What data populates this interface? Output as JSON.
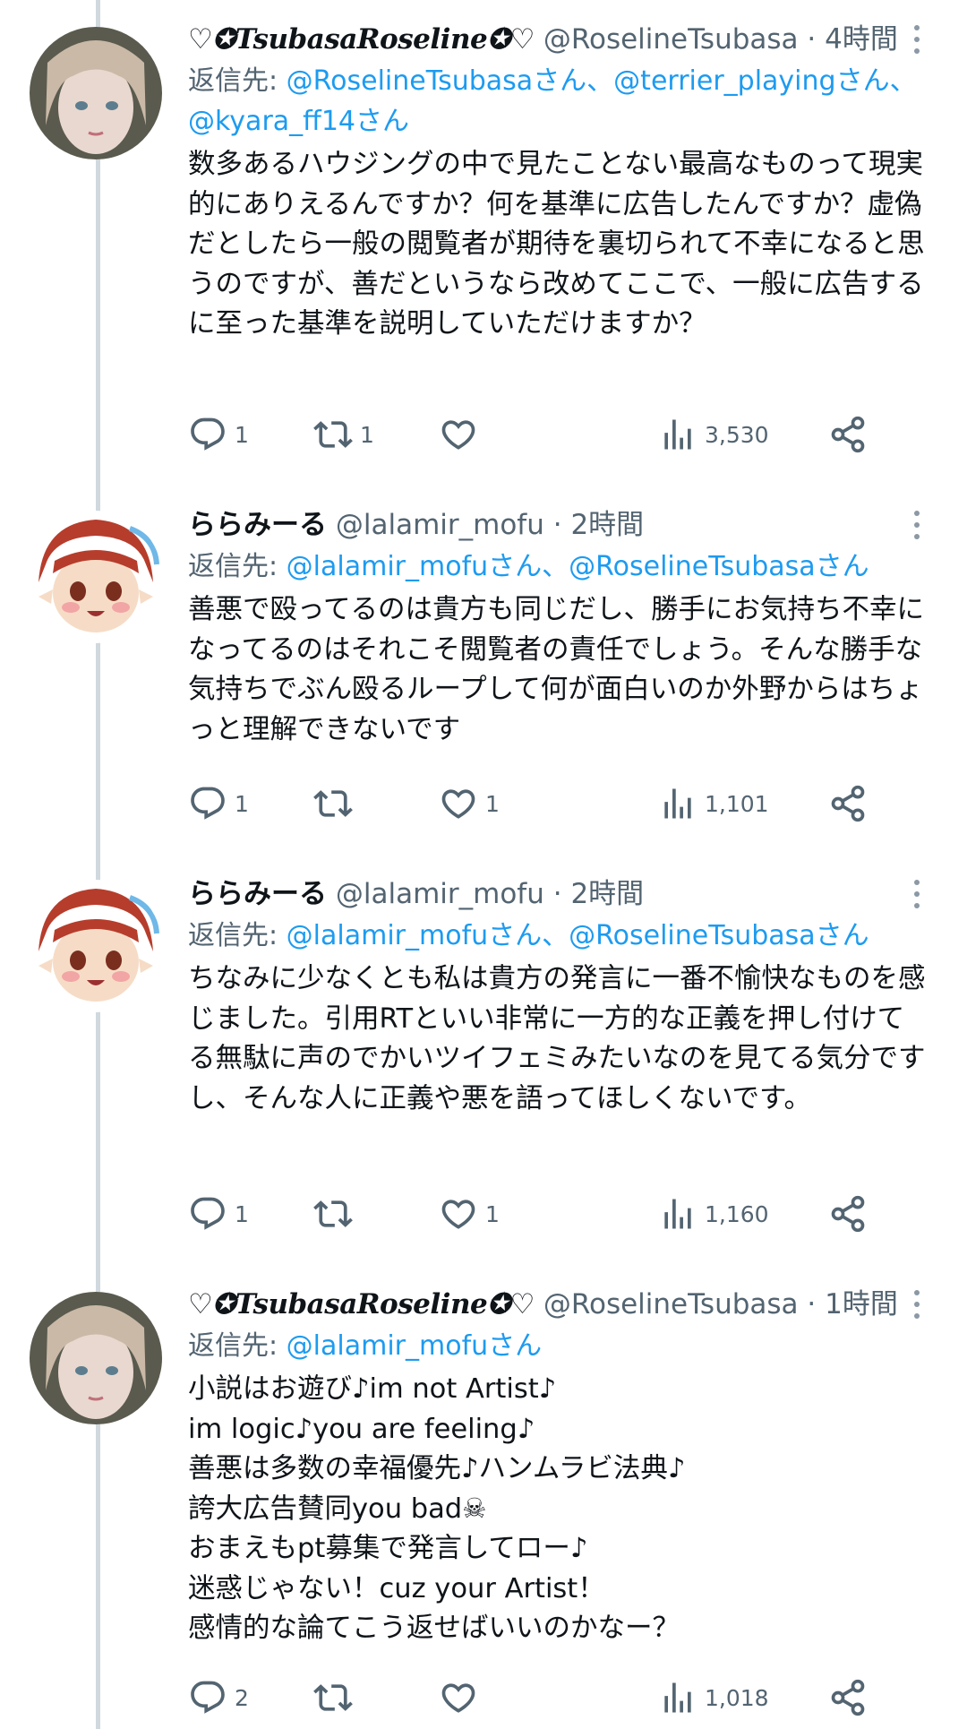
{
  "tweets": [
    {
      "name": "♡✪TsubasaRoseline✪♡",
      "handle": "@RoselineTsubasa",
      "separator": "·",
      "time": "4時間",
      "reply_prefix": "返信先: ",
      "reply_mentions_1": "@RoselineTsubasaさん、@terrier_playingさん、",
      "reply_mentions_2": "@kyara_ff14さん",
      "body": [
        "数多あるハウジングの中で見たことない最高なものって現実的にありえるんですか？何を基準に広告したんですか？虚偽だとしたら一般の閲覧者が期待を裏切られて不幸になると思うのですが、善だというなら改めてここで、一般に広告するに至った基準を説明していただけますか？"
      ],
      "replies": "1",
      "retweets": "1",
      "likes": "",
      "views": "3,530"
    },
    {
      "name": "ららみーる",
      "handle": "@lalamir_mofu",
      "separator": "·",
      "time": "2時間",
      "reply_prefix": "返信先: ",
      "reply_mentions_1": "@lalamir_mofuさん、@RoselineTsubasaさん",
      "body": [
        "善悪で殴ってるのは貴方も同じだし、勝手にお気持ち不幸になってるのはそれこそ閲覧者の責任でしょう。そんな勝手な気持ちでぶん殴るループして何が面白いのか外野からはちょっと理解できないです"
      ],
      "replies": "1",
      "retweets": "",
      "likes": "1",
      "views": "1,101"
    },
    {
      "name": "ららみーる",
      "handle": "@lalamir_mofu",
      "separator": "·",
      "time": "2時間",
      "reply_prefix": "返信先: ",
      "reply_mentions_1": "@lalamir_mofuさん、@RoselineTsubasaさん",
      "body": [
        "ちなみに少なくとも私は貴方の発言に一番不愉快なものを感じました。引用RTといい非常に一方的な正義を押し付けてる無駄に声のでかいツイフェミみたいなのを見てる気分ですし、そんな人に正義や悪を語ってほしくないです。"
      ],
      "replies": "1",
      "retweets": "",
      "likes": "1",
      "views": "1,160"
    },
    {
      "name": "♡✪TsubasaRoseline✪♡",
      "handle": "@RoselineTsubasa",
      "separator": "·",
      "time": "1時間",
      "reply_prefix": "返信先: ",
      "reply_mentions_1": "@lalamir_mofuさん",
      "body": [
        "小説はお遊び♪im not Artist♪",
        "im logic♪you are feeling♪",
        "善悪は多数の幸福優先♪ハンムラビ法典♪",
        "誇大広告賛同you bad☠",
        "おまえもpt募集で発言してロー♪",
        "迷惑じゃない！cuz your Artist！",
        "感情的な論てこう返せばいいのかなー？"
      ],
      "replies": "2",
      "retweets": "",
      "likes": "",
      "views": "1,018"
    }
  ],
  "icons": [
    "reply-icon",
    "retweet-icon",
    "like-icon",
    "views-icon",
    "share-icon",
    "more-icon"
  ],
  "colors": {
    "link": "#1d9bf0",
    "secondary": "#536471",
    "thread": "#cfd9de"
  }
}
